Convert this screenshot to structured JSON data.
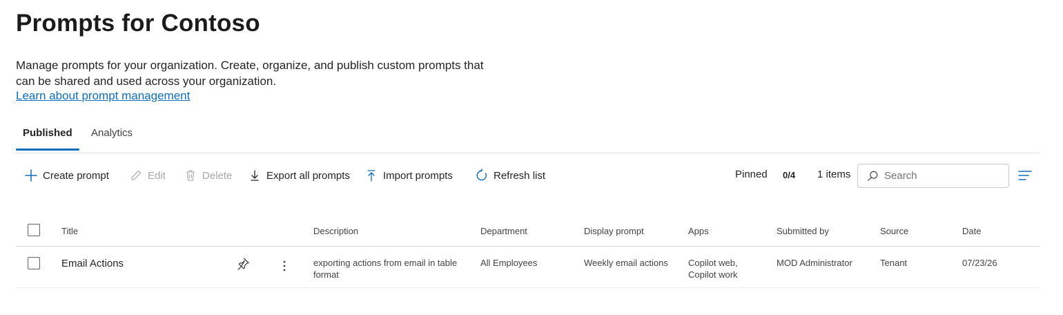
{
  "page": {
    "title": "Prompts for Contoso",
    "description": "Manage prompts for your organization. Create, organize, and publish custom prompts that can be shared and used across your organization.",
    "learn_link": "Learn about prompt management"
  },
  "tabs": [
    {
      "label": "Published",
      "active": true
    },
    {
      "label": "Analytics",
      "active": false
    }
  ],
  "toolbar": {
    "create": "Create prompt",
    "edit": "Edit",
    "delete": "Delete",
    "export": "Export all prompts",
    "import": "Import prompts",
    "refresh": "Refresh list",
    "pinned_label": "Pinned",
    "pinned_count": "0/4",
    "items_count": "1 items",
    "search_placeholder": "Search"
  },
  "table": {
    "columns": [
      "Title",
      "Description",
      "Department",
      "Display prompt",
      "Apps",
      "Submitted by",
      "Source",
      "Date"
    ],
    "rows": [
      {
        "title": "Email Actions",
        "description": "exporting actions from email in table format",
        "department": "All Employees",
        "display_prompt": "Weekly email actions",
        "apps": "Copilot web, Copilot work",
        "submitted_by": "MOD Administrator",
        "source": "Tenant",
        "date": "07/23/26"
      }
    ]
  },
  "colors": {
    "accent": "#0f6cbd",
    "text": "#242424",
    "disabled": "#a8a8a8"
  },
  "icons": {
    "create": "plus-icon",
    "edit": "pencil-icon",
    "delete": "trash-icon",
    "export": "download-icon",
    "import": "upload-icon",
    "refresh": "refresh-icon",
    "search": "search-icon",
    "filter": "filter-icon",
    "pin": "pin-icon",
    "more": "more-vertical-icon"
  }
}
